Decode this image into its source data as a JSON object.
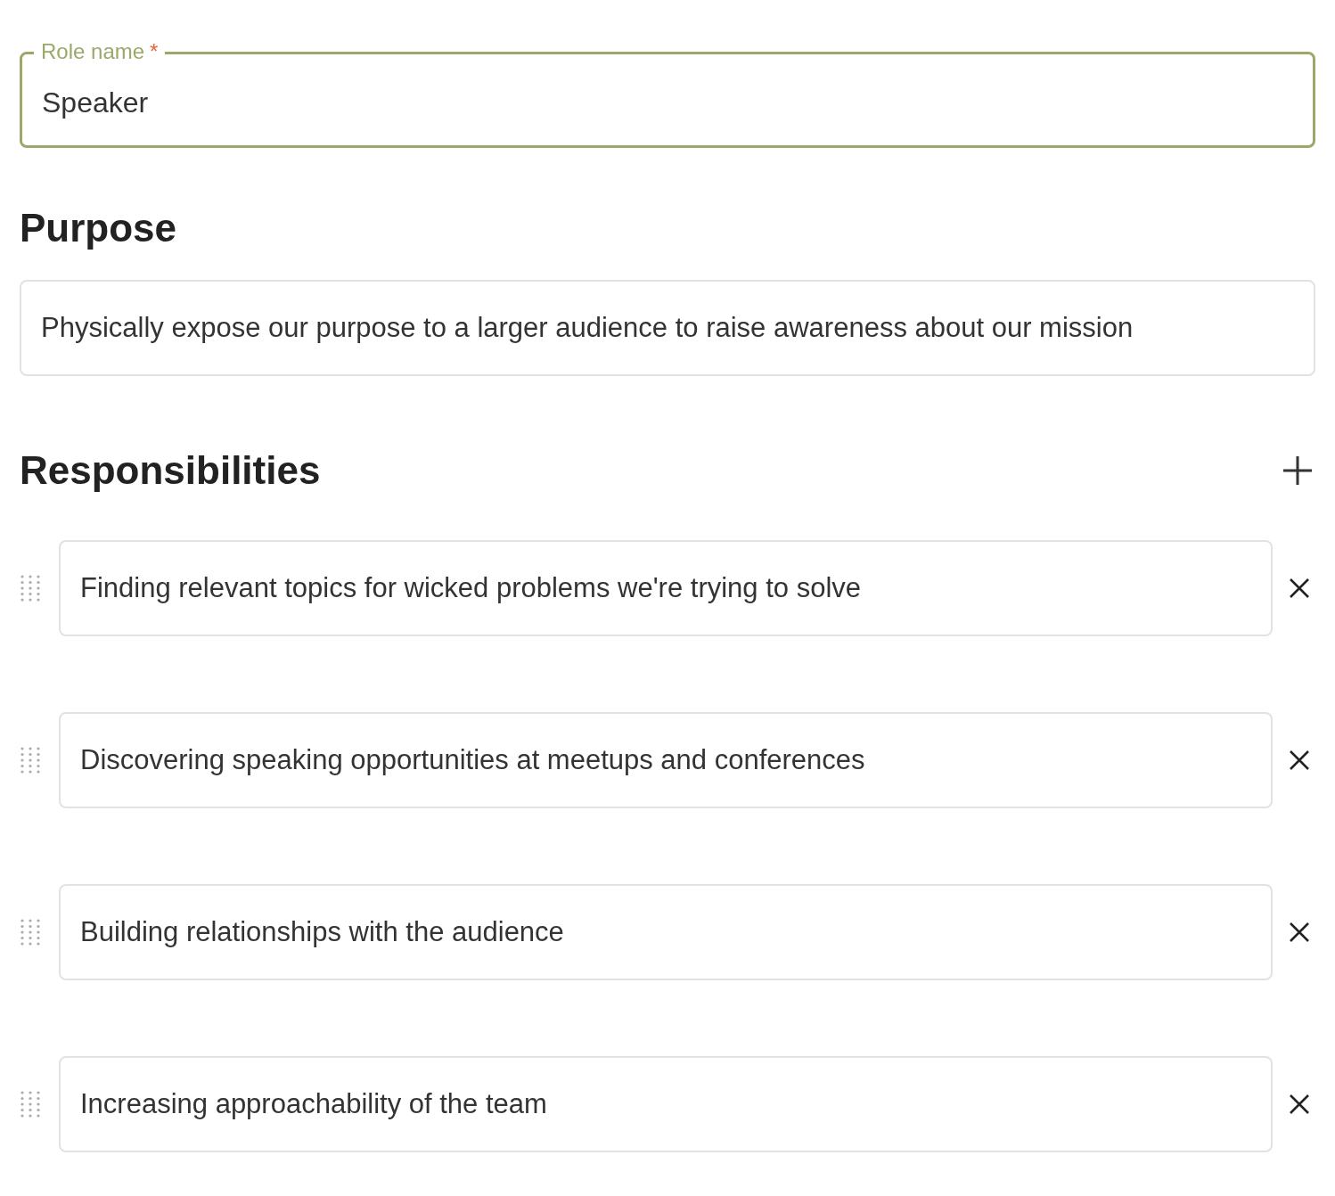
{
  "role_name": {
    "label": "Role name",
    "required_mark": "*",
    "value": "Speaker",
    "focused": true
  },
  "purpose": {
    "heading": "Purpose",
    "value": "Physically expose our purpose to a larger audience to raise awareness about our mission"
  },
  "responsibilities": {
    "heading": "Responsibilities",
    "items": [
      {
        "value": "Finding relevant topics for wicked problems we're trying to solve"
      },
      {
        "value": "Discovering speaking opportunities at meetups and conferences"
      },
      {
        "value": "Building relationships with the audience"
      },
      {
        "value": "Increasing approachability of the team"
      }
    ]
  }
}
